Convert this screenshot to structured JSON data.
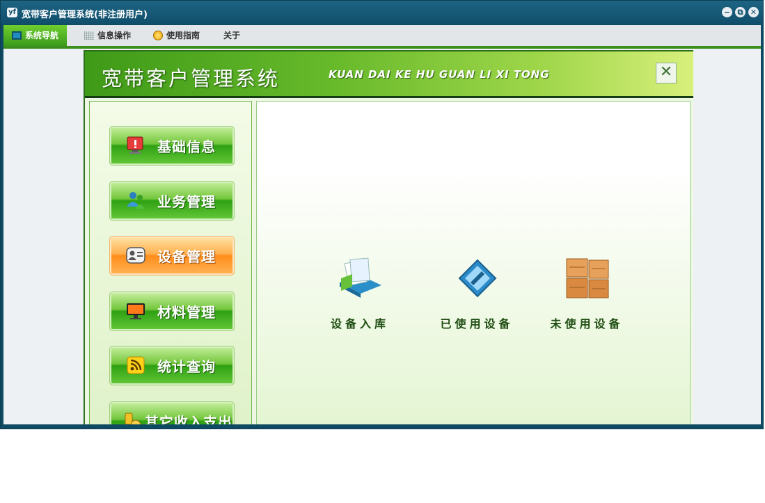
{
  "window": {
    "app_icon": "yf",
    "title": "宽带客户管理系统(非注册用户)",
    "controls": {
      "minimize": "−",
      "restore": "⧉",
      "close": "✕"
    }
  },
  "menu": [
    {
      "label": "系统导航",
      "icon": "monitor-icon",
      "active": true
    },
    {
      "label": "信息操作",
      "icon": "grid-icon"
    },
    {
      "label": "使用指南",
      "icon": "bulb-icon"
    },
    {
      "label": "关于",
      "icon": ""
    }
  ],
  "header": {
    "title": "宽带客户管理系统",
    "pinyin": "KUAN DAI KE HU GUAN LI XI TONG",
    "close_symbol": "✕"
  },
  "sidebar": [
    {
      "label": "基础信息",
      "icon": "alert-monitor-icon"
    },
    {
      "label": "业务管理",
      "icon": "users-icon"
    },
    {
      "label": "设备管理",
      "icon": "contact-card-icon",
      "active": true
    },
    {
      "label": "材料管理",
      "icon": "display-icon"
    },
    {
      "label": "统计查询",
      "icon": "rss-icon"
    },
    {
      "label": "其它收入支出",
      "icon": "coins-icon"
    }
  ],
  "tiles": [
    {
      "label": "设备入库",
      "icon": "warehouse-in-icon"
    },
    {
      "label": "已使用设备",
      "icon": "used-device-icon"
    },
    {
      "label": "未使用设备",
      "icon": "boxes-icon"
    }
  ]
}
